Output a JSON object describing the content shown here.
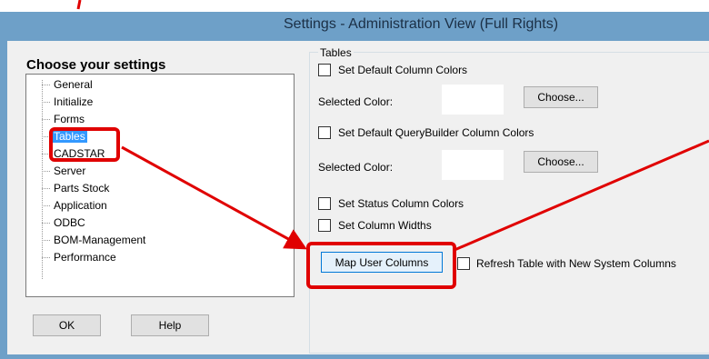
{
  "window": {
    "title": "Settings - Administration View (Full Rights)"
  },
  "left": {
    "heading": "Choose your settings",
    "tree_items": [
      "General",
      "Initialize",
      "Forms",
      "Tables",
      "CADSTAR",
      "Server",
      "Parts Stock",
      "Application",
      "ODBC",
      "BOM-Management",
      "Performance"
    ],
    "selected_item": "Tables",
    "ok_label": "OK",
    "help_label": "Help"
  },
  "right": {
    "group_title": "Tables",
    "default_col_colors_label": "Set Default Column Colors",
    "selected_color_label_1": "Selected Color:",
    "choose_label_1": "Choose...",
    "default_qb_colors_label": "Set Default QueryBuilder Column Colors",
    "selected_color_label_2": "Selected Color:",
    "choose_label_2": "Choose...",
    "status_col_colors_label": "Set Status Column Colors",
    "col_widths_label": "Set Column Widths",
    "map_user_columns_label": "Map User Columns",
    "refresh_table_label": "Refresh Table with New System Columns"
  },
  "colors": {
    "titlebar": "#6ea0c8",
    "selection": "#3399ff",
    "annotation": "#e00000"
  }
}
